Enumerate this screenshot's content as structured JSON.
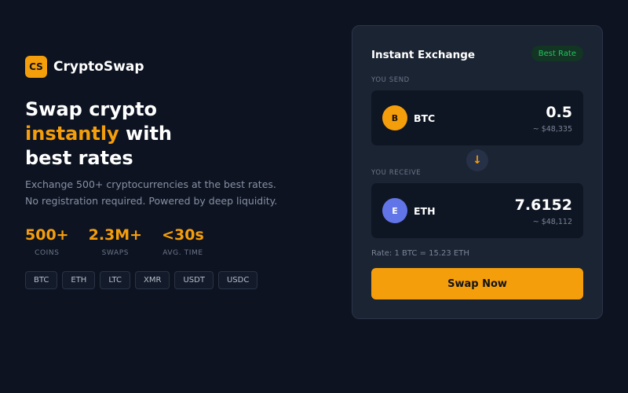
{
  "brand": {
    "logo_text": "CS",
    "name": "CryptoSwap"
  },
  "hero": {
    "headline_line1": "Swap crypto",
    "headline_accent": "instantly",
    "headline_line2_rest": " with",
    "headline_line3": "best rates",
    "subtitle_line1": "Exchange 500+ cryptocurrencies at the best rates.",
    "subtitle_line2": "No registration required. Powered by deep liquidity."
  },
  "stats": [
    {
      "value": "500+",
      "label": "COINS"
    },
    {
      "value": "2.3M+",
      "label": "SWAPS"
    },
    {
      "value": "<30s",
      "label": "AVG. TIME"
    }
  ],
  "chips": [
    "BTC",
    "ETH",
    "LTC",
    "XMR",
    "USDT",
    "USDC"
  ],
  "exchange": {
    "title": "Instant Exchange",
    "badge": "Best Rate",
    "send": {
      "label": "YOU SEND",
      "coin_initial": "B",
      "symbol": "BTC",
      "amount": "0.5",
      "fiat": "~ $48,335"
    },
    "direction_arrow": "↓",
    "receive": {
      "label": "YOU RECEIVE",
      "coin_initial": "E",
      "symbol": "ETH",
      "amount": "7.6152",
      "fiat": "~ $48,112"
    },
    "rate": "Rate: 1 BTC = 15.23 ETH",
    "button_label": "Swap Now"
  },
  "colors": {
    "background": "#0d1321",
    "accent": "#f59e0b",
    "card": "#1b2433",
    "badge_green": "#22c55e",
    "eth_coin": "#6275e8"
  }
}
